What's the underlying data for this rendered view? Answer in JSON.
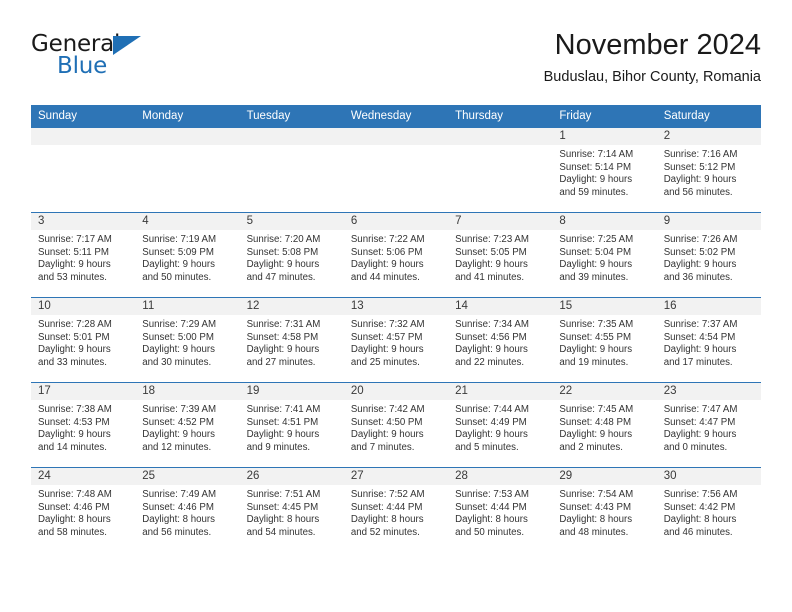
{
  "brand": {
    "name_top": "General",
    "name_bottom": "Blue",
    "accent_color": "#1f6fb5"
  },
  "header": {
    "title": "November 2024",
    "subtitle": "Buduslau, Bihor County, Romania"
  },
  "calendar": {
    "header_color": "#2e75b6",
    "daynum_band_color": "#f2f2f2",
    "weekdays": [
      "Sunday",
      "Monday",
      "Tuesday",
      "Wednesday",
      "Thursday",
      "Friday",
      "Saturday"
    ],
    "labels": {
      "sunrise": "Sunrise:",
      "sunset": "Sunset:",
      "daylight": "Daylight:"
    },
    "weeks": [
      [
        {
          "day": "",
          "empty": true
        },
        {
          "day": "",
          "empty": true
        },
        {
          "day": "",
          "empty": true
        },
        {
          "day": "",
          "empty": true
        },
        {
          "day": "",
          "empty": true
        },
        {
          "day": "1",
          "sunrise": "Sunrise: 7:14 AM",
          "sunset": "Sunset: 5:14 PM",
          "daylight1": "Daylight: 9 hours",
          "daylight2": "and 59 minutes."
        },
        {
          "day": "2",
          "sunrise": "Sunrise: 7:16 AM",
          "sunset": "Sunset: 5:12 PM",
          "daylight1": "Daylight: 9 hours",
          "daylight2": "and 56 minutes."
        }
      ],
      [
        {
          "day": "3",
          "sunrise": "Sunrise: 7:17 AM",
          "sunset": "Sunset: 5:11 PM",
          "daylight1": "Daylight: 9 hours",
          "daylight2": "and 53 minutes."
        },
        {
          "day": "4",
          "sunrise": "Sunrise: 7:19 AM",
          "sunset": "Sunset: 5:09 PM",
          "daylight1": "Daylight: 9 hours",
          "daylight2": "and 50 minutes."
        },
        {
          "day": "5",
          "sunrise": "Sunrise: 7:20 AM",
          "sunset": "Sunset: 5:08 PM",
          "daylight1": "Daylight: 9 hours",
          "daylight2": "and 47 minutes."
        },
        {
          "day": "6",
          "sunrise": "Sunrise: 7:22 AM",
          "sunset": "Sunset: 5:06 PM",
          "daylight1": "Daylight: 9 hours",
          "daylight2": "and 44 minutes."
        },
        {
          "day": "7",
          "sunrise": "Sunrise: 7:23 AM",
          "sunset": "Sunset: 5:05 PM",
          "daylight1": "Daylight: 9 hours",
          "daylight2": "and 41 minutes."
        },
        {
          "day": "8",
          "sunrise": "Sunrise: 7:25 AM",
          "sunset": "Sunset: 5:04 PM",
          "daylight1": "Daylight: 9 hours",
          "daylight2": "and 39 minutes."
        },
        {
          "day": "9",
          "sunrise": "Sunrise: 7:26 AM",
          "sunset": "Sunset: 5:02 PM",
          "daylight1": "Daylight: 9 hours",
          "daylight2": "and 36 minutes."
        }
      ],
      [
        {
          "day": "10",
          "sunrise": "Sunrise: 7:28 AM",
          "sunset": "Sunset: 5:01 PM",
          "daylight1": "Daylight: 9 hours",
          "daylight2": "and 33 minutes."
        },
        {
          "day": "11",
          "sunrise": "Sunrise: 7:29 AM",
          "sunset": "Sunset: 5:00 PM",
          "daylight1": "Daylight: 9 hours",
          "daylight2": "and 30 minutes."
        },
        {
          "day": "12",
          "sunrise": "Sunrise: 7:31 AM",
          "sunset": "Sunset: 4:58 PM",
          "daylight1": "Daylight: 9 hours",
          "daylight2": "and 27 minutes."
        },
        {
          "day": "13",
          "sunrise": "Sunrise: 7:32 AM",
          "sunset": "Sunset: 4:57 PM",
          "daylight1": "Daylight: 9 hours",
          "daylight2": "and 25 minutes."
        },
        {
          "day": "14",
          "sunrise": "Sunrise: 7:34 AM",
          "sunset": "Sunset: 4:56 PM",
          "daylight1": "Daylight: 9 hours",
          "daylight2": "and 22 minutes."
        },
        {
          "day": "15",
          "sunrise": "Sunrise: 7:35 AM",
          "sunset": "Sunset: 4:55 PM",
          "daylight1": "Daylight: 9 hours",
          "daylight2": "and 19 minutes."
        },
        {
          "day": "16",
          "sunrise": "Sunrise: 7:37 AM",
          "sunset": "Sunset: 4:54 PM",
          "daylight1": "Daylight: 9 hours",
          "daylight2": "and 17 minutes."
        }
      ],
      [
        {
          "day": "17",
          "sunrise": "Sunrise: 7:38 AM",
          "sunset": "Sunset: 4:53 PM",
          "daylight1": "Daylight: 9 hours",
          "daylight2": "and 14 minutes."
        },
        {
          "day": "18",
          "sunrise": "Sunrise: 7:39 AM",
          "sunset": "Sunset: 4:52 PM",
          "daylight1": "Daylight: 9 hours",
          "daylight2": "and 12 minutes."
        },
        {
          "day": "19",
          "sunrise": "Sunrise: 7:41 AM",
          "sunset": "Sunset: 4:51 PM",
          "daylight1": "Daylight: 9 hours",
          "daylight2": "and 9 minutes."
        },
        {
          "day": "20",
          "sunrise": "Sunrise: 7:42 AM",
          "sunset": "Sunset: 4:50 PM",
          "daylight1": "Daylight: 9 hours",
          "daylight2": "and 7 minutes."
        },
        {
          "day": "21",
          "sunrise": "Sunrise: 7:44 AM",
          "sunset": "Sunset: 4:49 PM",
          "daylight1": "Daylight: 9 hours",
          "daylight2": "and 5 minutes."
        },
        {
          "day": "22",
          "sunrise": "Sunrise: 7:45 AM",
          "sunset": "Sunset: 4:48 PM",
          "daylight1": "Daylight: 9 hours",
          "daylight2": "and 2 minutes."
        },
        {
          "day": "23",
          "sunrise": "Sunrise: 7:47 AM",
          "sunset": "Sunset: 4:47 PM",
          "daylight1": "Daylight: 9 hours",
          "daylight2": "and 0 minutes."
        }
      ],
      [
        {
          "day": "24",
          "sunrise": "Sunrise: 7:48 AM",
          "sunset": "Sunset: 4:46 PM",
          "daylight1": "Daylight: 8 hours",
          "daylight2": "and 58 minutes."
        },
        {
          "day": "25",
          "sunrise": "Sunrise: 7:49 AM",
          "sunset": "Sunset: 4:46 PM",
          "daylight1": "Daylight: 8 hours",
          "daylight2": "and 56 minutes."
        },
        {
          "day": "26",
          "sunrise": "Sunrise: 7:51 AM",
          "sunset": "Sunset: 4:45 PM",
          "daylight1": "Daylight: 8 hours",
          "daylight2": "and 54 minutes."
        },
        {
          "day": "27",
          "sunrise": "Sunrise: 7:52 AM",
          "sunset": "Sunset: 4:44 PM",
          "daylight1": "Daylight: 8 hours",
          "daylight2": "and 52 minutes."
        },
        {
          "day": "28",
          "sunrise": "Sunrise: 7:53 AM",
          "sunset": "Sunset: 4:44 PM",
          "daylight1": "Daylight: 8 hours",
          "daylight2": "and 50 minutes."
        },
        {
          "day": "29",
          "sunrise": "Sunrise: 7:54 AM",
          "sunset": "Sunset: 4:43 PM",
          "daylight1": "Daylight: 8 hours",
          "daylight2": "and 48 minutes."
        },
        {
          "day": "30",
          "sunrise": "Sunrise: 7:56 AM",
          "sunset": "Sunset: 4:42 PM",
          "daylight1": "Daylight: 8 hours",
          "daylight2": "and 46 minutes."
        }
      ]
    ]
  }
}
